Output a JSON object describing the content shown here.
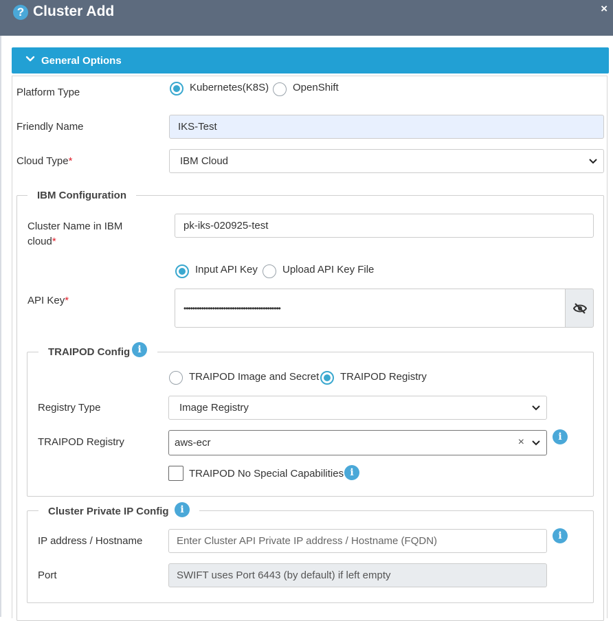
{
  "dialog": {
    "title": "Cluster Add",
    "close_label": "×",
    "help_glyph": "?"
  },
  "section": {
    "title": "General Options"
  },
  "platform": {
    "label": "Platform Type",
    "options": [
      {
        "label": "Kubernetes(K8S)",
        "selected": true
      },
      {
        "label": "OpenShift",
        "selected": false
      }
    ]
  },
  "friendly_name": {
    "label": "Friendly Name",
    "value": "IKS-Test"
  },
  "cloud_type": {
    "label": "Cloud Type",
    "required_mark": "*",
    "value": "IBM Cloud"
  },
  "ibm": {
    "legend": "IBM Configuration",
    "cluster_name": {
      "label_line1": "Cluster Name in IBM",
      "label_line2": "cloud",
      "required_mark": "*",
      "value": "pk-iks-020925-test"
    },
    "api_key_mode": [
      {
        "label": "Input API Key",
        "selected": true
      },
      {
        "label": "Upload API Key File",
        "selected": false
      }
    ],
    "api_key": {
      "label": "API Key",
      "required_mark": "*",
      "value": "••••••••••••••••••••••••••••••••••••••••••••"
    }
  },
  "traipod": {
    "legend": "TRAIPOD Config",
    "mode": [
      {
        "label": "TRAIPOD Image and Secret",
        "selected": false
      },
      {
        "label": "TRAIPOD Registry",
        "selected": true
      }
    ],
    "registry_type": {
      "label": "Registry Type",
      "value": "Image Registry"
    },
    "registry": {
      "label": "TRAIPOD Registry",
      "value": "aws-ecr",
      "clear": "×"
    },
    "no_special": {
      "label": "TRAIPOD No Special Capabilities",
      "checked": false
    }
  },
  "private_ip": {
    "legend": "Cluster Private IP Config",
    "ip": {
      "label": "IP address / Hostname",
      "placeholder": "Enter Cluster API Private IP address / Hostname (FQDN)"
    },
    "port": {
      "label": "Port",
      "placeholder": "SWIFT uses Port 6443 (by default) if left empty"
    }
  },
  "icons": {
    "info": "i",
    "help": "question-circle-icon",
    "eye": "eye-slash-icon"
  },
  "colors": {
    "header": "#5d6b7e",
    "accent": "#22a0d4",
    "info": "#4aa8d8",
    "required": "#e0202b",
    "autofill": "#e8f0fe"
  }
}
